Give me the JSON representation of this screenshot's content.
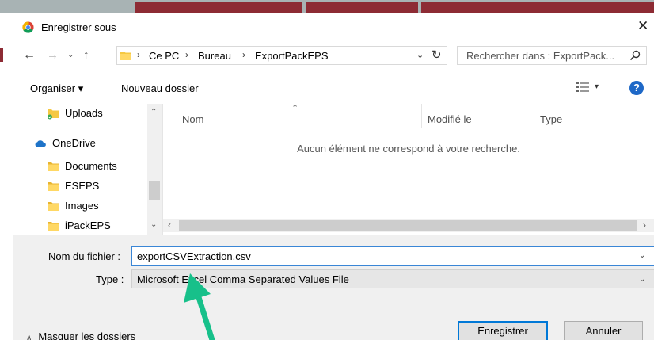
{
  "dialog": {
    "title": "Enregistrer sous",
    "close_glyph": "✕"
  },
  "nav": {
    "back_glyph": "←",
    "forward_glyph": "→",
    "recent_glyph": "⌄",
    "up_glyph": "↑",
    "breadcrumb": [
      {
        "label": "Ce PC"
      },
      {
        "label": "Bureau"
      },
      {
        "label": "ExportPackEPS"
      }
    ],
    "breadcrumb_sep": "›",
    "dropdown_glyph": "⌄",
    "refresh_glyph": "↻",
    "search_placeholder": "Rechercher dans : ExportPack..."
  },
  "toolbar": {
    "organiser_label": "Organiser ▾",
    "new_folder_label": "Nouveau dossier",
    "view_dropdown_glyph": "▾",
    "help_glyph": "?"
  },
  "nav_tree": {
    "items": [
      {
        "label": "Uploads",
        "icon": "folder-sync-icon"
      },
      {
        "label": "OneDrive",
        "icon": "onedrive-icon"
      },
      {
        "label": "Documents",
        "icon": "folder-icon"
      },
      {
        "label": "ESEPS",
        "icon": "folder-icon"
      },
      {
        "label": "Images",
        "icon": "folder-icon"
      },
      {
        "label": "iPackEPS",
        "icon": "folder-icon"
      }
    ],
    "scroll_up_glyph": "⌃",
    "scroll_down_glyph": "⌄"
  },
  "content": {
    "columns": [
      {
        "label": "Nom"
      },
      {
        "label": "Modifié le"
      },
      {
        "label": "Type"
      }
    ],
    "sort_glyph": "⌃",
    "empty_message": "Aucun élément ne correspond à votre recherche.",
    "scroll_left_glyph": "‹",
    "scroll_right_glyph": "›"
  },
  "form": {
    "filename_label": "Nom du fichier :",
    "filename_value": "exportCSVExtraction.csv",
    "type_label": "Type :",
    "type_value": "Microsoft Excel Comma Separated Values File",
    "dropdown_glyph": "⌄"
  },
  "footer": {
    "hide_folders_glyph": "∧",
    "hide_folders_label": "Masquer les dossiers",
    "save_label": "Enregistrer",
    "cancel_label": "Annuler"
  },
  "colors": {
    "annotation_arrow": "#17c08a",
    "accent_blue": "#0078d7",
    "help_blue": "#1e68c7",
    "folder_yellow": "#f5c842",
    "onedrive_blue": "#1e73c8",
    "bg_app_red": "#8d2b34"
  }
}
